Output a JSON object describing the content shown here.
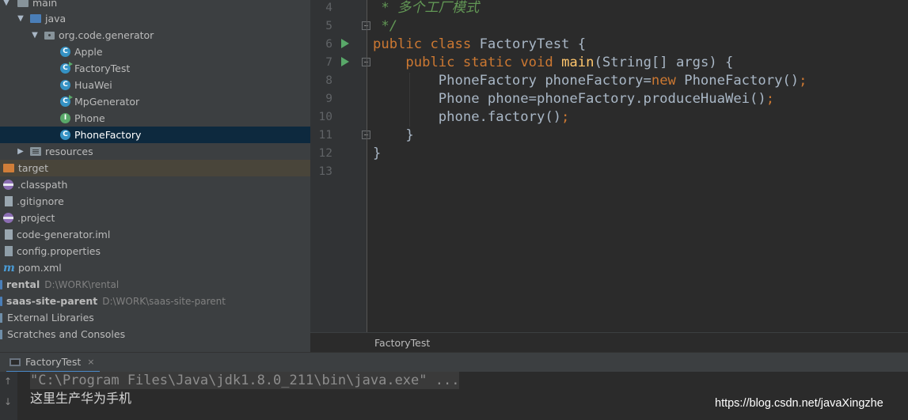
{
  "project_tree": {
    "items": [
      {
        "label": "main",
        "path": ""
      },
      {
        "label": "java",
        "path": ""
      },
      {
        "label": "org.code.generator",
        "path": ""
      },
      {
        "label": "Apple",
        "path": ""
      },
      {
        "label": "FactoryTest",
        "path": ""
      },
      {
        "label": "HuaWei",
        "path": ""
      },
      {
        "label": "MpGenerator",
        "path": ""
      },
      {
        "label": "Phone",
        "path": ""
      },
      {
        "label": "PhoneFactory",
        "path": ""
      },
      {
        "label": "resources",
        "path": ""
      },
      {
        "label": "target",
        "path": ""
      },
      {
        "label": ".classpath",
        "path": ""
      },
      {
        "label": ".gitignore",
        "path": ""
      },
      {
        "label": ".project",
        "path": ""
      },
      {
        "label": "code-generator.iml",
        "path": ""
      },
      {
        "label": "config.properties",
        "path": ""
      },
      {
        "label": "pom.xml",
        "path": ""
      },
      {
        "label": "rental",
        "path": "D:\\WORK\\rental"
      },
      {
        "label": "saas-site-parent",
        "path": "D:\\WORK\\saas-site-parent"
      },
      {
        "label": "External Libraries",
        "path": ""
      },
      {
        "label": "Scratches and Consoles",
        "path": ""
      }
    ],
    "selected": "PhoneFactory",
    "class_badge": "C",
    "interface_badge": "I",
    "maven_badge": "m"
  },
  "editor": {
    "line_numbers": [
      "4",
      "5",
      "6",
      "7",
      "8",
      "9",
      "10",
      "11",
      "12",
      "13"
    ],
    "comment_star": " * 多个工厂模式",
    "comment_end": " */",
    "kw_public": "public",
    "kw_class": "class",
    "class_name": "FactoryTest",
    "brace_open": " {",
    "kw_static": "static",
    "kw_void": "void",
    "method_name": "main",
    "main_params": "(String[] args) {",
    "line8_decl": "PhoneFactory phoneFactory=",
    "kw_new": "new",
    "line8_ctor": " PhoneFactory()",
    "semicolon": ";",
    "line9": "Phone phone=phoneFactory.produceHuaWei()",
    "line10": "phone.factory()",
    "close_inner": "}",
    "close_outer": "}",
    "breadcrumb": "FactoryTest"
  },
  "run_panel": {
    "tab_label": "FactoryTest",
    "close_symbol": "×",
    "up_arrow": "↑",
    "down_arrow": "↓",
    "command_line": "\"C:\\Program Files\\Java\\jdk1.8.0_211\\bin\\java.exe\" ...",
    "output_line": "这里生产华为手机"
  },
  "watermark": "https://blog.csdn.net/javaXingzhe",
  "colors": {
    "keyword": "#cc7832",
    "method": "#ffc66d",
    "comment": "#629755",
    "text": "#a9b7c6",
    "selection": "#0d293e"
  }
}
